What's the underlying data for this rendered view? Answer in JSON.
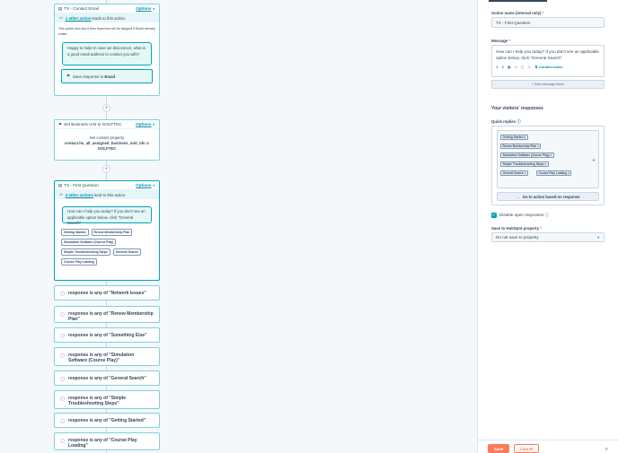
{
  "cards": {
    "contact_email": {
      "title": "TS - Contact Email",
      "options": "Options",
      "sub_prefix": "",
      "sub_link": "1 other action",
      "sub_suffix": "leads to this action.",
      "note": "This action and any it then branches will be skipped if Email already exists.",
      "bubble": "Happy to help! In case we disconnect, what is a good email address to contact you with?",
      "save_prefix": "Save response to",
      "save_prop": "Email"
    },
    "business_unit": {
      "title": "Set Business Unit to GOLFTEC",
      "options": "Options",
      "line1": "Set contact property",
      "line2": "contact.hs_all_assigned_business_unit_ids",
      "to": "to",
      "value": "GOLFTEC"
    },
    "first_question": {
      "title": "TS - First Question",
      "options": "Options",
      "sub_link": "4 other actions",
      "sub_suffix": "lead to this action.",
      "bubble": "How can I help you today? If you don't see an applicable option below, click \"General Search\"",
      "chips": [
        "Getting Started",
        "Renew Membership Plan",
        "Simulation Software (Course Play)",
        "Simple Troubleshooting Steps",
        "General Search",
        "Course Play Loading"
      ]
    }
  },
  "branches": [
    "response is any of \"Network Issues\"",
    "response is any of \"Renew Membership Plan\"",
    "response is any of \"Something Else\"",
    "response is any of \"Simulation Software (Course Play)\"",
    "response is any of \"General Search\"",
    "response is any of \"Simple Troubleshooting Steps\"",
    "response is any of \"Getting Started\"",
    "response is any of \"Course Play Loading\""
  ],
  "panel": {
    "action_name_label": "Action name (internal only)",
    "action_name_value": "TS - First Question",
    "message_label": "Message",
    "message_value": "How can I help you today? If you don't see an applicable option below, click \"General Search\"",
    "contact_token": "Contact token",
    "add_message_block": "+ Add message block",
    "visitors_heading": "Your visitors' responses",
    "quick_replies_label": "Quick replies",
    "quick_replies": [
      "Getting Started",
      "Renew Membership Plan",
      "Simulation Software (Course Play)",
      "Simple Troubleshooting Steps",
      "General Search",
      "Course Play Loading"
    ],
    "go_to_action": "Go to action based on response",
    "disable_open": "Disable open responses",
    "save_to_label": "Save to HubSpot property",
    "save_to_value": "Do not save to property",
    "save_btn": "Save",
    "cancel_btn": "Cancel",
    "page_num": "0"
  },
  "colors": {
    "accent": "#00a4bd",
    "save": "#ff7a59",
    "text": "#33475b"
  }
}
